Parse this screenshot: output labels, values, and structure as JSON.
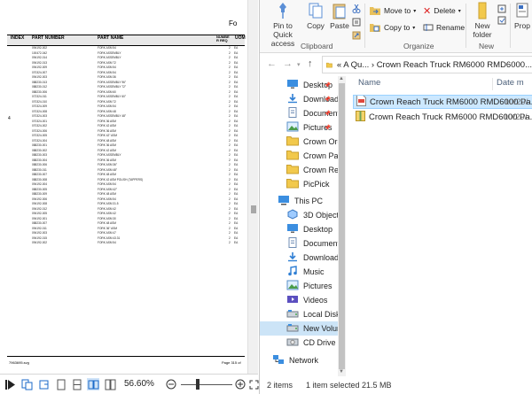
{
  "pdf": {
    "corner_mark": "Fo",
    "side_mark": "4",
    "headers": {
      "index": "INDEX",
      "part_number": "PART NUMBER",
      "part_name": "PART NAME",
      "number": "NUMBE R REQ",
      "uom": "UOM"
    },
    "rows": [
      [
        "094192-002",
        "FORK ASM 54",
        "2",
        "EA"
      ],
      [
        "100472-042",
        "FORK ASSEMBLY",
        "2",
        "EA"
      ],
      [
        "094192-014",
        "FORK ASSEMBLY",
        "2",
        "EA"
      ],
      [
        "094192-013",
        "FORK ASM 72",
        "2",
        "EA"
      ],
      [
        "094192-009",
        "FORK ASM 54",
        "2",
        "EA"
      ],
      [
        "070324-007",
        "FORK ASM 54",
        "2",
        "EA"
      ],
      [
        "094192-003",
        "FORK ASM 36",
        "2",
        "EA"
      ],
      [
        "088230-013",
        "FORK ASSEMBLY 96\"",
        "2",
        "EA"
      ],
      [
        "088230-012",
        "FORK ASSEMBLY 72\"",
        "2",
        "EA"
      ],
      [
        "088230-006",
        "FORK ASM 60",
        "2",
        "EA"
      ],
      [
        "072324-011",
        "FORK ASSEMBLY 60\"",
        "2",
        "EA"
      ],
      [
        "070324-010",
        "FORK ASM 72",
        "2",
        "EA"
      ],
      [
        "070324-009",
        "FORK ASM 54",
        "2",
        "EA"
      ],
      [
        "070324-008",
        "FORK ASM 48",
        "2",
        "EA"
      ],
      [
        "070324-003",
        "FORK ASSEMBLY 48\"",
        "2",
        "EA"
      ],
      [
        "070324-001",
        "FORK 36 ASM",
        "2",
        "EA"
      ],
      [
        "070324-002",
        "FORK 42 ASM",
        "2",
        "EA"
      ],
      [
        "070324-006",
        "FORK 36 ASM",
        "2",
        "EA"
      ],
      [
        "070324-005",
        "FORK 42\" ASM",
        "2",
        "EA"
      ],
      [
        "070324-004",
        "FORK 48 ASM",
        "2",
        "EA"
      ],
      [
        "088230-001",
        "FORK 36 ASM",
        "2",
        "EA"
      ],
      [
        "088230-002",
        "FORK 42 ASM",
        "2",
        "EA"
      ],
      [
        "088230-003",
        "FORK ASSEMBLY",
        "2",
        "EA"
      ],
      [
        "088230-004",
        "FORK 36 ASM",
        "2",
        "EA"
      ],
      [
        "088230-006",
        "FORK ASM 36\"",
        "2",
        "EA"
      ],
      [
        "088230-011",
        "FORK ASM 48\"",
        "2",
        "EA"
      ],
      [
        "088230-007",
        "FORK 48 ASM",
        "2",
        "EA"
      ],
      [
        "088230-008",
        "FORK 42 ASM POLISH (TAPPERS)",
        "2",
        "EA"
      ],
      [
        "094192-004",
        "FORK ASM 54",
        "2",
        "EA"
      ],
      [
        "088230-005",
        "FORK ASM 42\"",
        "2",
        "EA"
      ],
      [
        "088230-009",
        "FORK 48 ASM",
        "2",
        "EA"
      ],
      [
        "094192-006",
        "FORK ASM 54",
        "2",
        "EA"
      ],
      [
        "094192-008",
        "FORK ASM 31.5",
        "2",
        "EA"
      ],
      [
        "094192-012",
        "FORK ASM 42",
        "2",
        "EA"
      ],
      [
        "094192-005",
        "FORK ASM 42",
        "2",
        "EA"
      ],
      [
        "094192-001",
        "FORK ASM 30",
        "2",
        "EA"
      ],
      [
        "088230-007",
        "FORK 48 ASM",
        "2",
        "EA"
      ],
      [
        "094192-011",
        "FORK 36\" ASM",
        "2",
        "EA"
      ],
      [
        "094192-003",
        "FORK ASM 47",
        "2",
        "EA"
      ],
      [
        "094192-015",
        "FORK ASM 43.31",
        "2",
        "EA"
      ],
      [
        "094192-002",
        "FORK ASM 54",
        "2",
        "EA"
      ]
    ],
    "footer_left": "7963695.svg",
    "footer_right": "Page 315 of",
    "zoom": "56.60%"
  },
  "ribbon": {
    "pin_label": "Pin to Quick access",
    "copy_label": "Copy",
    "paste_label": "Paste",
    "move_to": "Move to",
    "copy_to": "Copy to",
    "delete": "Delete",
    "rename": "Rename",
    "new_folder": "New folder",
    "properties": "Prop",
    "group_clipboard": "Clipboard",
    "group_organize": "Organize",
    "group_new": "New"
  },
  "address": {
    "path": "«  A Qu...  ›  Crown Reach Truck RM6000 RMD6000..."
  },
  "nav": {
    "items": [
      {
        "label": "Desktop",
        "pin": true,
        "icon": "desktop-blue"
      },
      {
        "label": "Downloads",
        "pin": true,
        "icon": "downloads"
      },
      {
        "label": "Documents",
        "pin": true,
        "icon": "documents"
      },
      {
        "label": "Pictures",
        "pin": true,
        "icon": "pictures"
      },
      {
        "label": "Crown Order F",
        "pin": false,
        "icon": "folder"
      },
      {
        "label": "Crown Pallet S",
        "pin": false,
        "icon": "folder"
      },
      {
        "label": "Crown Reach T",
        "pin": false,
        "icon": "folder"
      },
      {
        "label": "PicPick",
        "pin": false,
        "icon": "folder"
      },
      {
        "label": "This PC",
        "pin": false,
        "icon": "pc"
      },
      {
        "label": "3D Objects",
        "pin": false,
        "icon": "3d"
      },
      {
        "label": "Desktop",
        "pin": false,
        "icon": "desktop-blue"
      },
      {
        "label": "Documents",
        "pin": false,
        "icon": "documents"
      },
      {
        "label": "Downloads",
        "pin": false,
        "icon": "downloads"
      },
      {
        "label": "Music",
        "pin": false,
        "icon": "music"
      },
      {
        "label": "Pictures",
        "pin": false,
        "icon": "pictures"
      },
      {
        "label": "Videos",
        "pin": false,
        "icon": "videos"
      },
      {
        "label": "Local Disk (C:)",
        "pin": false,
        "icon": "disk"
      },
      {
        "label": "New Volume (",
        "pin": false,
        "icon": "disk",
        "selected": true
      },
      {
        "label": "CD Drive (F:)",
        "pin": false,
        "icon": "cd"
      },
      {
        "label": "Network",
        "pin": false,
        "icon": "network"
      }
    ]
  },
  "files": {
    "col_name": "Name",
    "col_date": "Date m",
    "rows": [
      {
        "name": "Crown Reach Truck RM6000 RMD6000 Pa...",
        "date": "10/29/",
        "selected": true,
        "icon": "pdf"
      },
      {
        "name": "Crown Reach Truck RM6000 RMD6000 Pa...",
        "date": "10/29/",
        "selected": false,
        "icon": "archive"
      }
    ]
  },
  "status": {
    "items": "2 items",
    "selected": "1 item selected  21.5 MB"
  }
}
